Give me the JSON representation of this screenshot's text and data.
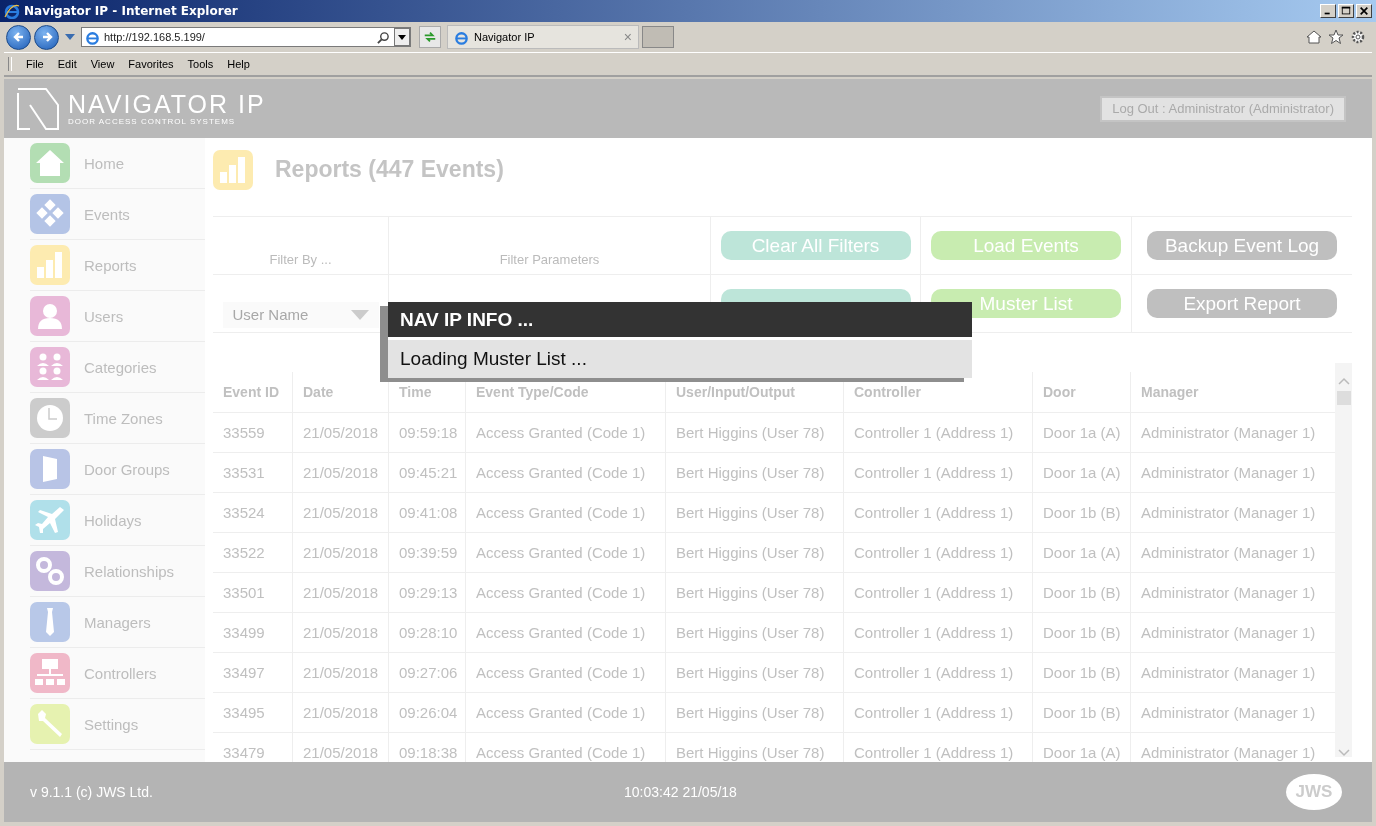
{
  "window": {
    "title": "Navigator IP - Internet Explorer"
  },
  "browser": {
    "address": "http://192.168.5.199/",
    "tab": "Navigator IP",
    "tab_close": "×",
    "menu": [
      "File",
      "Edit",
      "View",
      "Favorites",
      "Tools",
      "Help"
    ]
  },
  "header": {
    "brand": "NAVIGATOR IP",
    "tagline": "DOOR ACCESS CONTROL SYSTEMS",
    "logout": "Log Out : Administrator (Administrator)"
  },
  "sidebar": {
    "items": [
      {
        "label": "Home",
        "color": "#b3deb3"
      },
      {
        "label": "Events",
        "color": "#b4c4e6"
      },
      {
        "label": "Reports",
        "color": "#fdebb0"
      },
      {
        "label": "Users",
        "color": "#e8b8d8"
      },
      {
        "label": "Categories",
        "color": "#e8b8d8"
      },
      {
        "label": "Time Zones",
        "color": "#cccccc"
      },
      {
        "label": "Door Groups",
        "color": "#b8c4e6"
      },
      {
        "label": "Holidays",
        "color": "#b0e0ea"
      },
      {
        "label": "Relationships",
        "color": "#c4b8dc"
      },
      {
        "label": "Managers",
        "color": "#b8c8e8"
      },
      {
        "label": "Controllers",
        "color": "#f0b8c8"
      },
      {
        "label": "Settings",
        "color": "#e6f2b0"
      }
    ]
  },
  "page": {
    "title": "Reports (447 Events)"
  },
  "filters": {
    "filter_by": "Filter By ...",
    "filter_parameters": "Filter Parameters",
    "field": "User Name",
    "buttons": [
      {
        "label": "Clear All Filters",
        "color": "#bde5d9"
      },
      {
        "label": "Load Events",
        "color": "#c8ecb0"
      },
      {
        "label": "Backup Event Log",
        "color": "#bfbfbf"
      },
      {
        "color": "#bde5d9"
      },
      {
        "label": "Muster List",
        "color": "#c8ecb0"
      },
      {
        "label": "Export Report",
        "color": "#bfbfbf"
      }
    ]
  },
  "table": {
    "columns": [
      "Event ID",
      "Date",
      "Time",
      "Event Type/Code",
      "User/Input/Output",
      "Controller",
      "Door",
      "Manager"
    ],
    "rows": [
      [
        "33559",
        "21/05/2018",
        "09:59:18",
        "Access Granted (Code 1)",
        "Bert Higgins (User 78)",
        "Controller 1 (Address 1)",
        "Door 1a (A)",
        "Administrator (Manager 1)"
      ],
      [
        "33531",
        "21/05/2018",
        "09:45:21",
        "Access Granted (Code 1)",
        "Bert Higgins (User 78)",
        "Controller 1 (Address 1)",
        "Door 1a (A)",
        "Administrator (Manager 1)"
      ],
      [
        "33524",
        "21/05/2018",
        "09:41:08",
        "Access Granted (Code 1)",
        "Bert Higgins (User 78)",
        "Controller 1 (Address 1)",
        "Door 1b (B)",
        "Administrator (Manager 1)"
      ],
      [
        "33522",
        "21/05/2018",
        "09:39:59",
        "Access Granted (Code 1)",
        "Bert Higgins (User 78)",
        "Controller 1 (Address 1)",
        "Door 1a (A)",
        "Administrator (Manager 1)"
      ],
      [
        "33501",
        "21/05/2018",
        "09:29:13",
        "Access Granted (Code 1)",
        "Bert Higgins (User 78)",
        "Controller 1 (Address 1)",
        "Door 1b (B)",
        "Administrator (Manager 1)"
      ],
      [
        "33499",
        "21/05/2018",
        "09:28:10",
        "Access Granted (Code 1)",
        "Bert Higgins (User 78)",
        "Controller 1 (Address 1)",
        "Door 1b (B)",
        "Administrator (Manager 1)"
      ],
      [
        "33497",
        "21/05/2018",
        "09:27:06",
        "Access Granted (Code 1)",
        "Bert Higgins (User 78)",
        "Controller 1 (Address 1)",
        "Door 1b (B)",
        "Administrator (Manager 1)"
      ],
      [
        "33495",
        "21/05/2018",
        "09:26:04",
        "Access Granted (Code 1)",
        "Bert Higgins (User 78)",
        "Controller 1 (Address 1)",
        "Door 1b (B)",
        "Administrator (Manager 1)"
      ],
      [
        "33479",
        "21/05/2018",
        "09:18:38",
        "Access Granted (Code 1)",
        "Bert Higgins (User 78)",
        "Controller 1 (Address 1)",
        "Door 1a (A)",
        "Administrator (Manager 1)"
      ]
    ]
  },
  "dialog": {
    "title": "NAV IP INFO ...",
    "message": "Loading Muster List ..."
  },
  "footer": {
    "version": "v 9.1.1 (c) JWS Ltd.",
    "clock": "10:03:42 21/05/18",
    "logo": "JWS"
  }
}
